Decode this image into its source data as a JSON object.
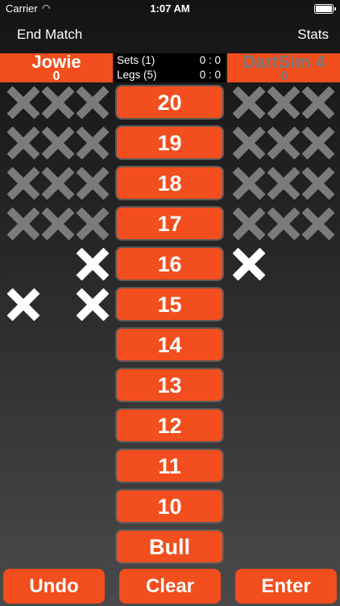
{
  "status": {
    "carrier": "Carrier",
    "time": "1:07 AM"
  },
  "nav": {
    "end_match": "End Match",
    "stats": "Stats"
  },
  "players": {
    "left": {
      "name": "Jowie",
      "score": "0"
    },
    "right": {
      "name": "DartSim 4",
      "score": "0"
    }
  },
  "info": {
    "sets_label": "Sets (1)",
    "sets_value": "0 : 0",
    "legs_label": "Legs (5)",
    "legs_value": "0 : 0"
  },
  "numbers": [
    "20",
    "19",
    "18",
    "17",
    "16",
    "15",
    "14",
    "13",
    "12",
    "11",
    "10",
    "Bull"
  ],
  "marks": {
    "left": [
      [
        "closed",
        "closed",
        "closed"
      ],
      [
        "closed",
        "closed",
        "closed"
      ],
      [
        "closed",
        "closed",
        "closed"
      ],
      [
        "closed",
        "closed",
        "closed"
      ],
      [
        "",
        "",
        "open"
      ],
      [
        "open",
        "",
        "open"
      ]
    ],
    "right": [
      [
        "closed",
        "closed",
        "closed"
      ],
      [
        "closed",
        "closed",
        "closed"
      ],
      [
        "closed",
        "closed",
        "closed"
      ],
      [
        "closed",
        "closed",
        "closed"
      ],
      [
        "open",
        "",
        ""
      ],
      [
        "",
        "",
        ""
      ]
    ]
  },
  "buttons": {
    "undo": "Undo",
    "clear": "Clear",
    "enter": "Enter"
  },
  "colors": {
    "accent": "#f24e1e",
    "closed_mark": "#7b7b7b",
    "open_mark": "#ffffff"
  }
}
